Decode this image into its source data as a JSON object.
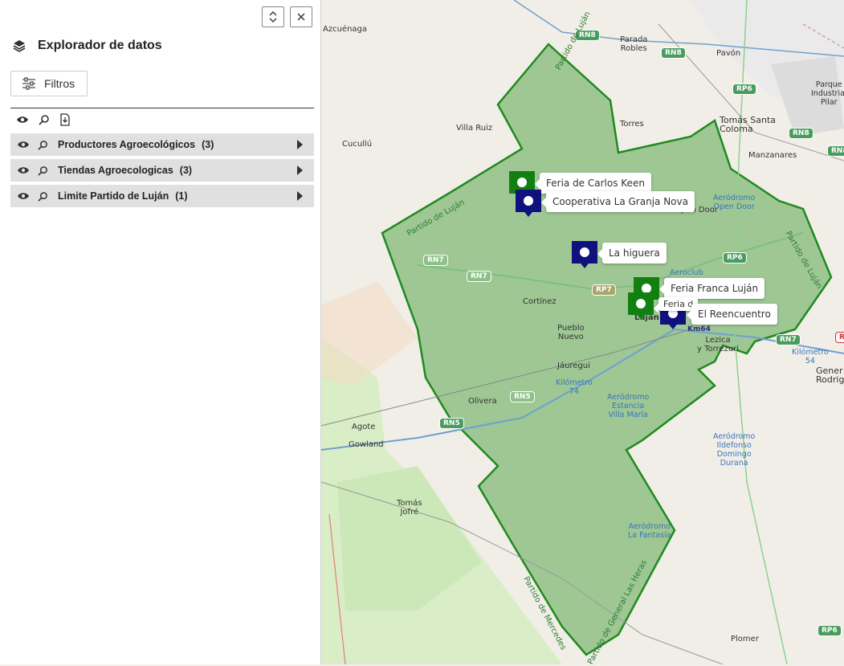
{
  "panel": {
    "title": "Explorador de datos",
    "filters_label": "Filtros",
    "layers": [
      {
        "name": "Productores Agroecológicos",
        "count": "(3)"
      },
      {
        "name": "Tiendas Agroecologicas",
        "count": "(3)"
      },
      {
        "name": "Limite Partido de Luján",
        "count": "(1)"
      }
    ]
  },
  "map": {
    "places": {
      "azcuenaga": "Azcuénaga",
      "parada_robles": "Parada\nRobles",
      "pavon": "Pavón",
      "parque_industrial": "Parque\nIndustrial\nPilar",
      "tomas_santa_coloma": "Tomás Santa\nColoma",
      "manzanares": "Manzanares",
      "villa_ruiz": "Villa Ruiz",
      "cucullu": "Cucullú",
      "torres": "Torres",
      "open_door": "Open Door",
      "aerodromo_open_door": "Aeródromo\nOpen Door",
      "aeroclub": "Aeroclub",
      "cortinez": "Cortínez",
      "pueblo_nuevo": "Pueblo\nNuevo",
      "lezica": "Lezica\ny Torrezuri",
      "jauregui": "Jáuregui",
      "kilometro_74": "Kilómetro\n74",
      "kilometro_54": "Kilómetro\n54",
      "general_rodriguez": "Gener\nRodrigu",
      "olivera": "Olivera",
      "aerodromo_villa_maria": "Aeródromo\nEstancia\nVilla María",
      "aerodromo_ildefonso": "Aeródromo\nIldefonso\nDomingo\nDurana",
      "agote": "Agote",
      "gowland": "Gowland",
      "tomas_jofre": "Tomás\nJofré",
      "aerodromo_la_fantasia": "Aeródromo\nLa Fantasía",
      "plomer": "Plomer",
      "lujan_partial": "Luján"
    },
    "shields": {
      "rn8_a": "RN8",
      "rn8_b": "RN8",
      "rn8_c": "RN8",
      "rp6_a": "RP6",
      "rp6_b": "RP6",
      "rp6_c": "RP6",
      "rn7_a": "RN7",
      "rn7_b": "RN7",
      "rn7_c": "RN7",
      "rp7": "RP7",
      "rn5_a": "RN5",
      "rn5_b": "RN5",
      "km64": "Km64",
      "rn_red": "R"
    },
    "boundary_labels": {
      "lujan_ne": "Partido de Luján",
      "lujan_w": "Partido de Luján",
      "lujan_e": "Partido de Luján",
      "mercedes": "Partido de Mercedes",
      "las_heras": "Partido de General Las Heras"
    },
    "markers": [
      {
        "label": "Feria de Carlos Keen",
        "color": "green"
      },
      {
        "label": "Cooperativa La Granja Nova",
        "color": "navy"
      },
      {
        "label": "La higuera",
        "color": "navy"
      },
      {
        "label": "Feria Franca Luján",
        "color": "green"
      },
      {
        "label": "Feria d",
        "color": "green"
      },
      {
        "label": "El Reencuentro",
        "color": "navy"
      }
    ]
  }
}
